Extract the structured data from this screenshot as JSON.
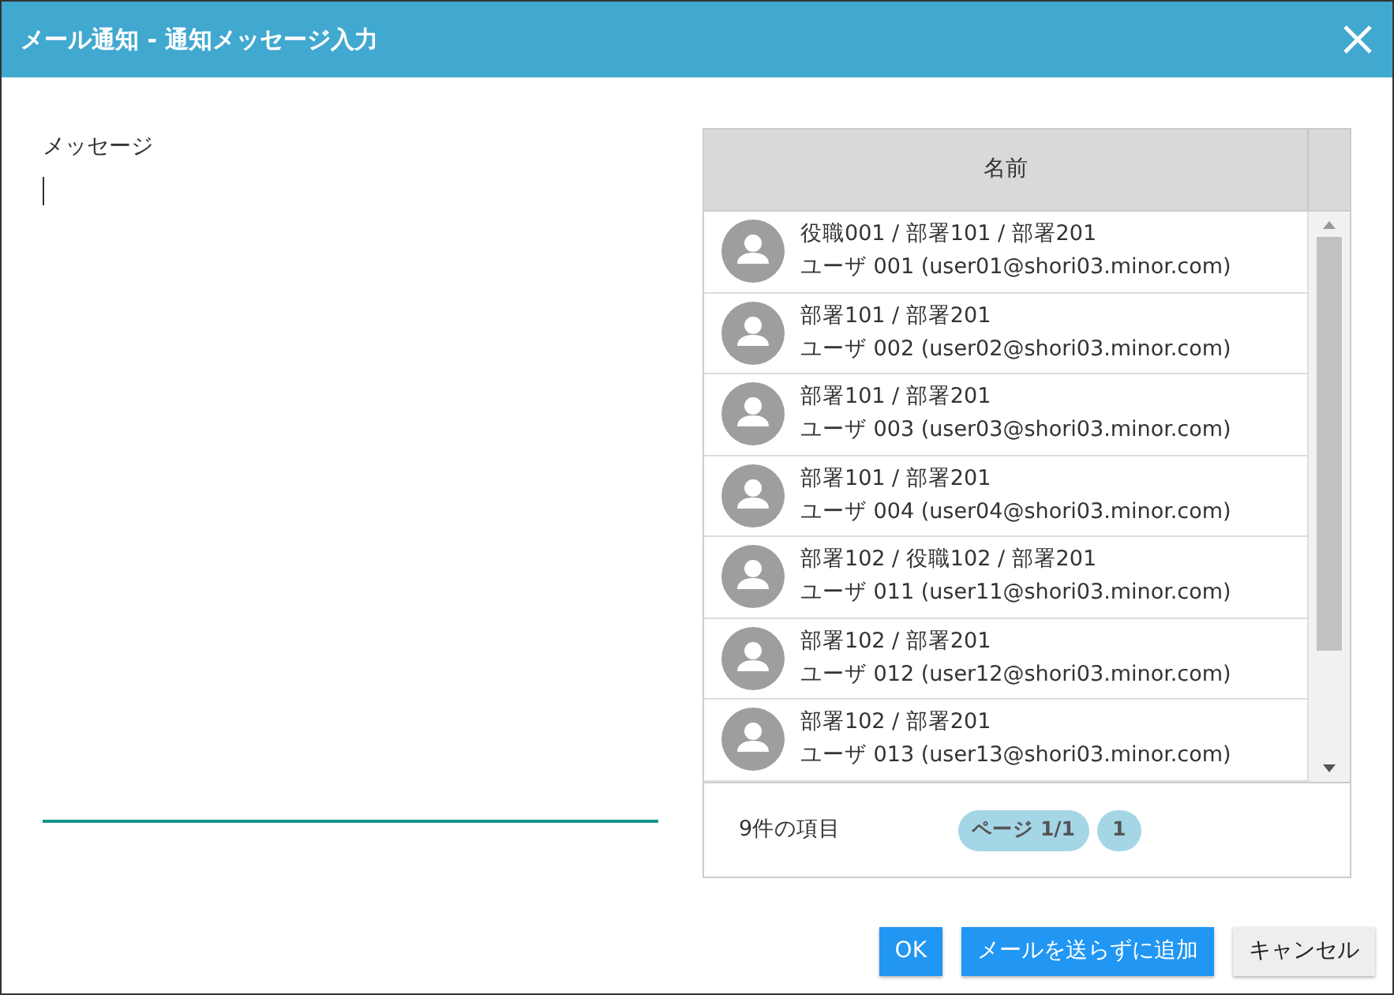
{
  "window": {
    "title": "メール通知 - 通知メッセージ入力"
  },
  "message": {
    "label": "メッセージ"
  },
  "table": {
    "columns": [
      "名前"
    ],
    "rows": [
      {
        "line_1": "役職001 / 部署101 / 部署201",
        "line_2": "ユーザ 001 (user01@shori03.minor.com)"
      },
      {
        "line_1": "部署101 / 部署201",
        "line_2": "ユーザ 002 (user02@shori03.minor.com)"
      },
      {
        "line_1": "部署101 / 部署201",
        "line_2": "ユーザ 003 (user03@shori03.minor.com)"
      },
      {
        "line_1": "部署101 / 部署201",
        "line_2": "ユーザ 004 (user04@shori03.minor.com)"
      },
      {
        "line_1": "部署102 / 役職102 / 部署201",
        "line_2": "ユーザ 011 (user11@shori03.minor.com)"
      },
      {
        "line_1": "部署102 / 部署201",
        "line_2": "ユーザ 012 (user12@shori03.minor.com)"
      },
      {
        "line_1": "部署102 / 部署201",
        "line_2": "ユーザ 013 (user13@shori03.minor.com)"
      }
    ],
    "footer": {
      "count": "9件の項目",
      "page": "ページ 1/1",
      "pages": [
        {
          "label": "1",
          "selected": true
        }
      ]
    }
  },
  "buttons": [
    {
      "label": "OK",
      "kind": "primary"
    },
    {
      "label": "メールを送らずに追加",
      "kind": "primary"
    },
    {
      "label": "キャンセル",
      "kind": "secondary"
    }
  ]
}
